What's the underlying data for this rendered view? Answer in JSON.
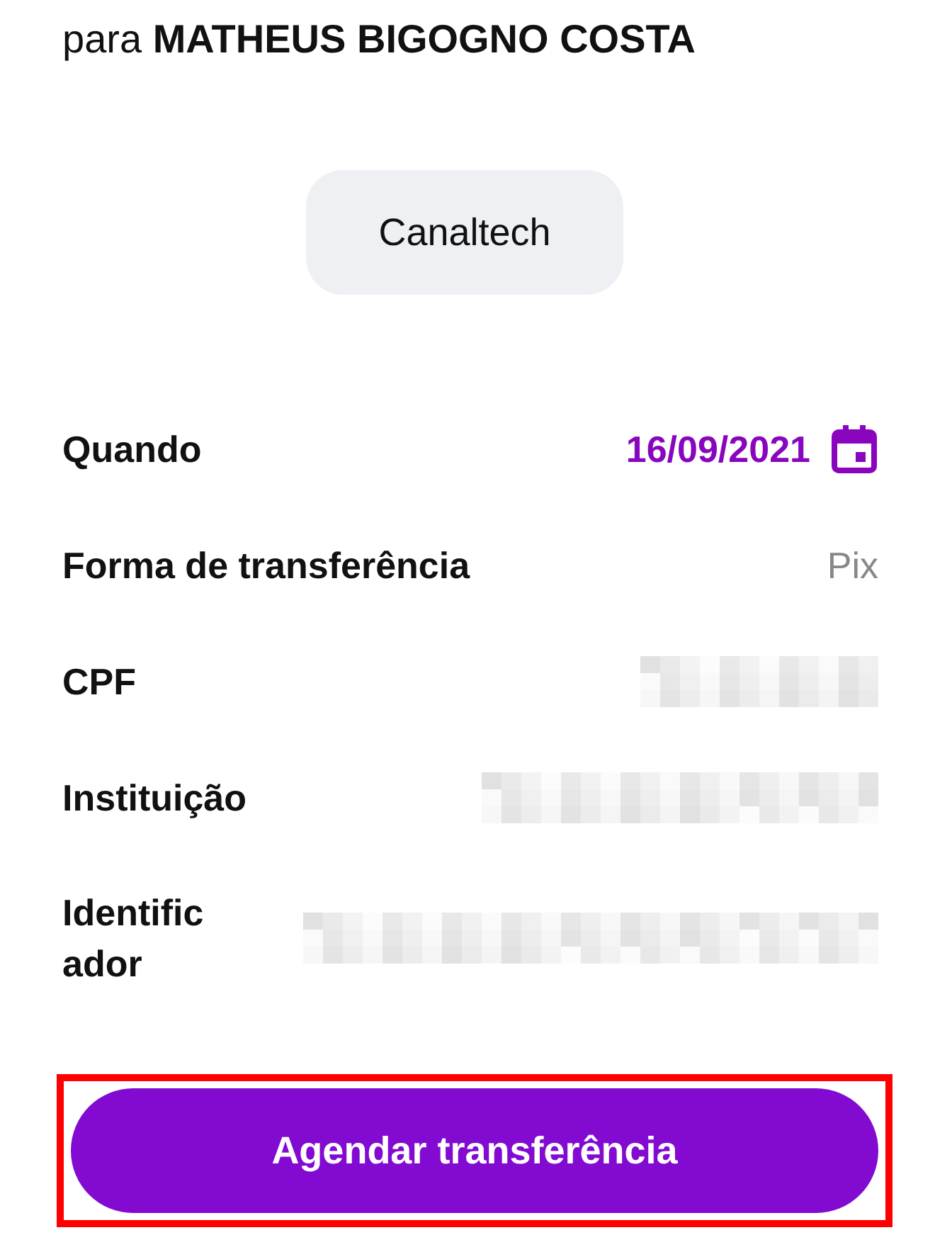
{
  "header": {
    "text": "para **MATHEUS BIGOGNO COSTA**"
  },
  "chip": {
    "label": "Canaltech"
  },
  "rows": [
    {
      "label": "Quando",
      "kind": "date",
      "value": "16/09/2021"
    },
    {
      "label": "Forma de transferência",
      "kind": "text",
      "value": "Pix"
    },
    {
      "label": "CPF",
      "kind": "redacted"
    },
    {
      "label": "Instituição",
      "kind": "redacted"
    },
    {
      "label": "Identific\nador",
      "kind": "redacted"
    }
  ],
  "button": {
    "label": "Agendar transferência",
    "highlighted": true
  }
}
